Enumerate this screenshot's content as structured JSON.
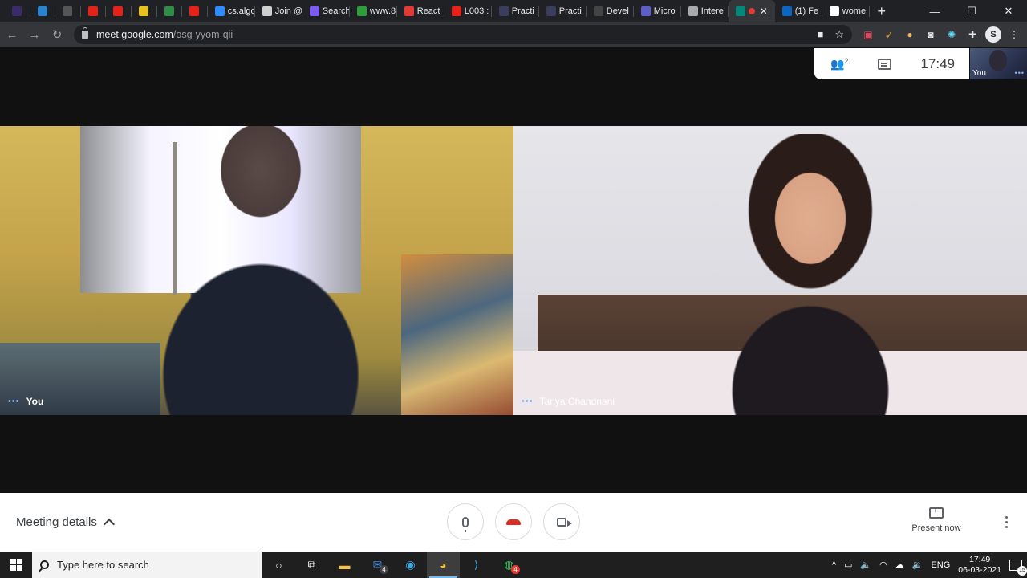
{
  "browser": {
    "tabs": [
      {
        "label": "",
        "icon": "onenote-icon",
        "color": "#3b2b6b"
      },
      {
        "label": "",
        "icon": "stack-icon",
        "color": "#2a83d0"
      },
      {
        "label": "",
        "icon": "zotero-icon",
        "color": "#555555"
      },
      {
        "label": "",
        "icon": "youtube-icon",
        "color": "#e62117"
      },
      {
        "label": "",
        "icon": "youtube-icon",
        "color": "#e62117"
      },
      {
        "label": "",
        "icon": "b-icon",
        "color": "#e8c21b"
      },
      {
        "label": "",
        "icon": "gfg-icon",
        "color": "#2f8d46"
      },
      {
        "label": "",
        "icon": "youtube-icon",
        "color": "#e62117"
      },
      {
        "label": "cs.algo",
        "icon": "zoom-icon",
        "color": "#2d8cff"
      },
      {
        "label": "Join @",
        "icon": "grid-icon",
        "color": "#d0d0d0"
      },
      {
        "label": "Search",
        "icon": "search-fav-icon",
        "color": "#7a5cf0"
      },
      {
        "label": "www.8",
        "icon": "b4-icon",
        "color": "#2d9e3a"
      },
      {
        "label": "React",
        "icon": "react-fav-icon",
        "color": "#e53935"
      },
      {
        "label": "L003 :",
        "icon": "youtube-icon",
        "color": "#e62117"
      },
      {
        "label": "Practi",
        "icon": "practice-icon",
        "color": "#3b3d5e"
      },
      {
        "label": "Practi",
        "icon": "practice-icon",
        "color": "#3b3d5e"
      },
      {
        "label": "Devel",
        "icon": "github-icon",
        "color": "#444444"
      },
      {
        "label": "Micro",
        "icon": "teams-icon",
        "color": "#5b5fc7"
      },
      {
        "label": "Intere",
        "icon": "cc-icon",
        "color": "#aaaaaa"
      },
      {
        "label": "",
        "icon": "meet-icon",
        "color": "#00897b",
        "active": true
      },
      {
        "label": "(1) Fe",
        "icon": "linkedin-icon",
        "color": "#0a66c2"
      },
      {
        "label": "wome",
        "icon": "google-icon",
        "color": "#ffffff"
      }
    ],
    "new_tab": "+",
    "window": {
      "minimize": "—",
      "maximize": "☐",
      "close": "✕"
    },
    "url_host": "meet.google.com",
    "url_path": "/osg-yyom-qii",
    "profile_letter": "S"
  },
  "meet": {
    "participants_count": "2",
    "clock": "17:49",
    "self_label": "You",
    "tiles": [
      {
        "name": "You"
      },
      {
        "name": "Tanya Chandnani"
      }
    ],
    "meeting_details": "Meeting details",
    "present_now": "Present now"
  },
  "taskbar": {
    "search_placeholder": "Type here to search",
    "mail_badge": "4",
    "whatsapp_badge": "4",
    "lang": "ENG",
    "time": "17:49",
    "date": "06-03-2021",
    "notifications": "15"
  }
}
